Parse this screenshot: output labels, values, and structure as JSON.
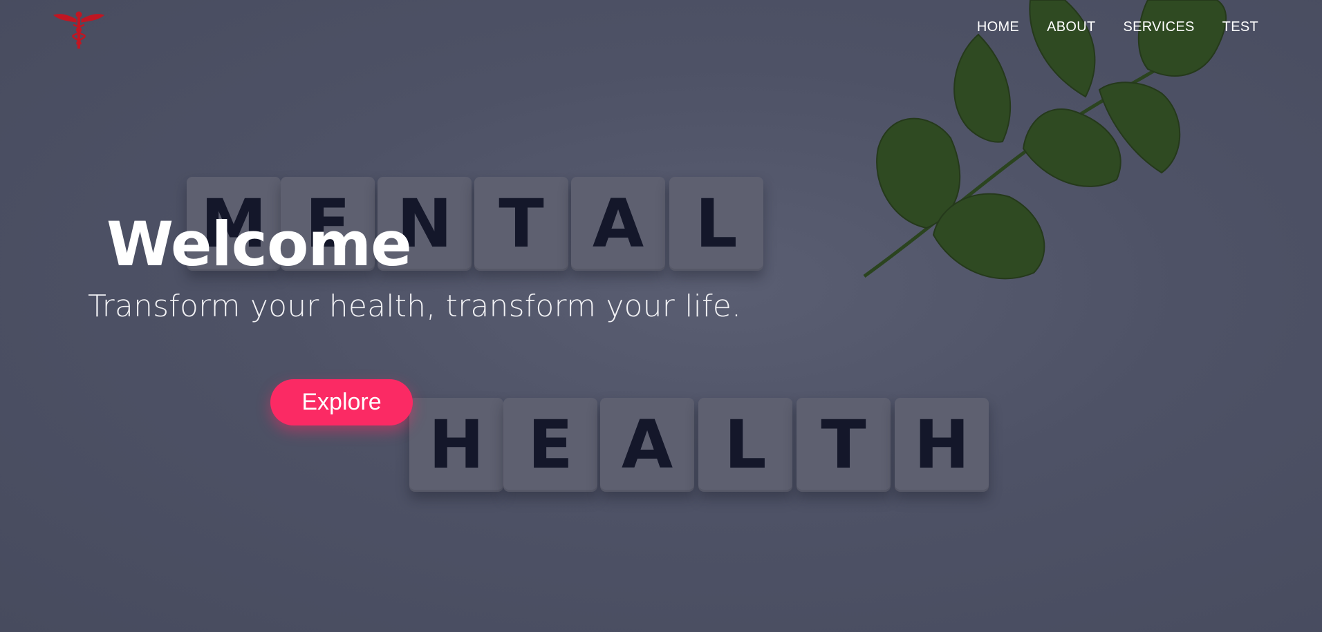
{
  "nav": {
    "items": [
      {
        "label": "HOME"
      },
      {
        "label": "ABOUT"
      },
      {
        "label": "SERVICES"
      },
      {
        "label": "TEST"
      }
    ]
  },
  "hero": {
    "title": "Welcome",
    "subtitle": "Transform your health, transform your life.",
    "cta_label": "Explore",
    "background_tiles_row1": [
      "M",
      "E",
      "N",
      "T",
      "A",
      "L"
    ],
    "background_tiles_row2": [
      "H",
      "E",
      "A",
      "L",
      "T",
      "H"
    ]
  },
  "icons": {
    "logo": "caduceus-icon"
  },
  "colors": {
    "accent": "#fb2a64",
    "logo": "#c01622",
    "overlay": "#4d5164",
    "leaf": "#2f4a22"
  }
}
